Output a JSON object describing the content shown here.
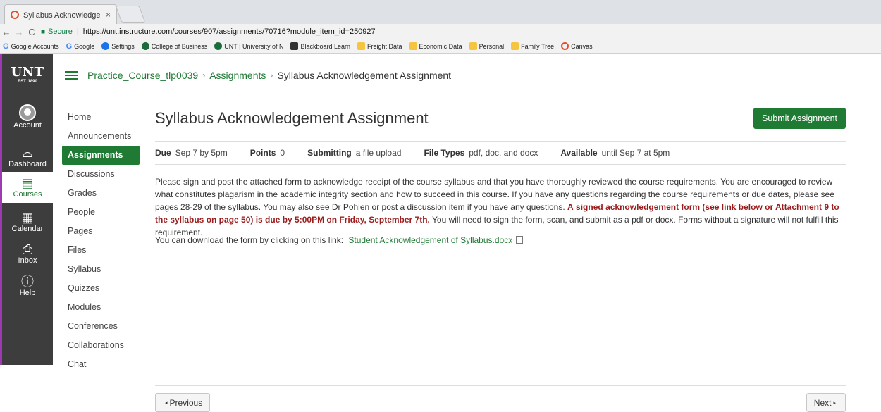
{
  "browser": {
    "tab_title": "Syllabus Acknowledgeme",
    "tab_close": "×",
    "secure_label": "Secure",
    "url": "https://unt.instructure.com/courses/907/assignments/70716?module_item_id=250927",
    "bookmarks": [
      {
        "label": "Google Accounts",
        "icon": "google-icon"
      },
      {
        "label": "Google",
        "icon": "google-icon"
      },
      {
        "label": "Settings",
        "icon": "gear-icon"
      },
      {
        "label": "College of Business",
        "icon": "unt-icon"
      },
      {
        "label": "UNT | University of N",
        "icon": "unt-icon"
      },
      {
        "label": "Blackboard Learn",
        "icon": "blackboard-icon"
      },
      {
        "label": "Freight Data",
        "icon": "folder-icon"
      },
      {
        "label": "Economic Data",
        "icon": "folder-icon"
      },
      {
        "label": "Personal",
        "icon": "folder-icon"
      },
      {
        "label": "Family Tree",
        "icon": "folder-icon"
      },
      {
        "label": "Canvas",
        "icon": "canvas-icon"
      }
    ]
  },
  "global_nav": {
    "logo_text": "UNT",
    "logo_sub": "EST. 1890",
    "items": [
      {
        "label": "Account",
        "icon": "account-icon"
      },
      {
        "label": "Dashboard",
        "icon": "dashboard-icon"
      },
      {
        "label": "Courses",
        "icon": "courses-icon"
      },
      {
        "label": "Calendar",
        "icon": "calendar-icon"
      },
      {
        "label": "Inbox",
        "icon": "inbox-icon"
      },
      {
        "label": "Help",
        "icon": "help-icon"
      }
    ],
    "accent": "#9d3ab1"
  },
  "breadcrumb": {
    "course": "Practice_Course_tlp0039",
    "section": "Assignments",
    "current": "Syllabus Acknowledgement Assignment"
  },
  "course_nav": [
    "Home",
    "Announcements",
    "Assignments",
    "Discussions",
    "Grades",
    "People",
    "Pages",
    "Files",
    "Syllabus",
    "Quizzes",
    "Modules",
    "Conferences",
    "Collaborations",
    "Chat"
  ],
  "course_nav_active": "Assignments",
  "assignment": {
    "title": "Syllabus Acknowledgement Assignment",
    "submit_label": "Submit Assignment",
    "due_label": "Due",
    "due_value": "Sep 7 by 5pm",
    "points_label": "Points",
    "points_value": "0",
    "submitting_label": "Submitting",
    "submitting_value": "a file upload",
    "filetypes_label": "File Types",
    "filetypes_value": "pdf, doc, and docx",
    "available_label": "Available",
    "available_value": "until Sep 7 at 5pm",
    "desc_part1": "Please sign and post the attached form to acknowledge receipt of the course syllabus and that you have thoroughly reviewed the course requirements.  You are encouraged to review what constitutes plagarism in the academic integrity section and how to succeed in this course.  If you have any questions regarding the course requirements or due dates, please see pages 28-29 of the syllabus.  You may also see Dr Pohlen or post a discussion item if you have any questions.",
    "desc_red_a": "A",
    "desc_red_signed": "signed",
    "desc_red_rest": "acknowledgement form (see link below or Attachment 9 to the syllabus on page 50) is due by 5:00PM on Friday, September 7th.",
    "desc_part2": "You will need to sign the form, scan, and submit as a pdf or docx.  Forms without a signature will not fulfill this requirement.",
    "download_text": "You can download the form by clicking on this link:",
    "download_link": "Student Acknowledgement of Syllabus.docx"
  },
  "pager": {
    "prev": "Previous",
    "next": "Next"
  },
  "colors": {
    "brand_green": "#1f7a34",
    "nav_bg": "#3d3d3d",
    "alert_red": "#9b1c1c"
  }
}
